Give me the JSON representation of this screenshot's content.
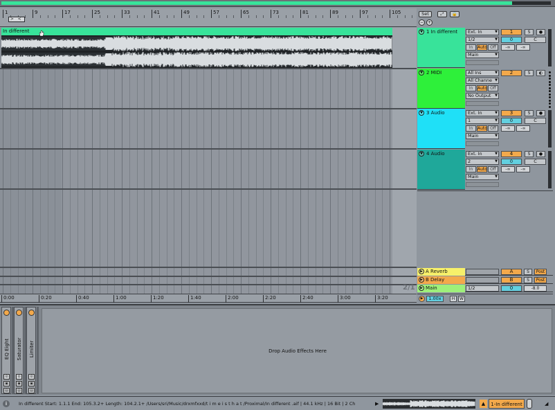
{
  "overview": {
    "fill_fraction": 0.93
  },
  "ruler": {
    "bars": [
      "1",
      "9",
      "17",
      "25",
      "33",
      "41",
      "49",
      "57",
      "65",
      "73",
      "81",
      "89",
      "97",
      "105"
    ]
  },
  "header_controls": {
    "set_label": "Set",
    "expand_glyph": "⤢",
    "lock_glyph": "🔒",
    "zoom_out_glyph": "−",
    "zoom_in_glyph": "+"
  },
  "clip": {
    "name": "In different",
    "color": "#38e39a"
  },
  "page_indicator": "2/1",
  "time_ruler": [
    "0:00",
    "0:20",
    "0:40",
    "1:00",
    "1:20",
    "1:40",
    "2:00",
    "2:20",
    "2:40",
    "3:00",
    "3:20"
  ],
  "tracks": [
    {
      "name": "1 In different",
      "color": "#38e39a",
      "input": "Ext. In",
      "channel": "1/2",
      "output": "Main",
      "mon": [
        "In",
        "Auto",
        "Off"
      ],
      "mon_on": 1,
      "num": "1",
      "solo": "S",
      "arm": "●",
      "volume": "0",
      "pan": "C",
      "peak_l": "-∞",
      "peak_r": "-∞"
    },
    {
      "name": "2 MIDI",
      "color": "#2ef03a",
      "input": "All Ins",
      "channel": "All Channe",
      "output": "No Output",
      "mon": [
        "In",
        "Auto",
        "Off"
      ],
      "mon_on": 1,
      "num": "2",
      "solo": "S",
      "arm": "◐"
    },
    {
      "name": "3 Audio",
      "color": "#1fe0f7",
      "input": "Ext. In",
      "channel": "1",
      "output": "Main",
      "mon": [
        "In",
        "Auto",
        "Off"
      ],
      "mon_on": 1,
      "num": "3",
      "solo": "S",
      "arm": "●",
      "volume": "0",
      "pan": "C",
      "peak_l": "-∞",
      "peak_r": "-∞"
    },
    {
      "name": "4 Audio",
      "color": "#1fa89a",
      "input": "Ext. In",
      "channel": "2",
      "output": "Main",
      "mon": [
        "In",
        "Auto",
        "Off"
      ],
      "mon_on": 1,
      "num": "4",
      "solo": "S",
      "arm": "●",
      "volume": "0",
      "pan": "C",
      "peak_l": "-∞",
      "peak_r": "-∞"
    }
  ],
  "returns": [
    {
      "name": "A Reverb",
      "letter": "A",
      "solo": "S",
      "post": "Post",
      "color": "#f7f06a"
    },
    {
      "name": "B Delay",
      "letter": "B",
      "solo": "S",
      "post": "Post",
      "color": "#f3a94b"
    }
  ],
  "main": {
    "name": "Main",
    "channel": "1/2",
    "volume": "0",
    "peak": "-8.0",
    "color": "#9ef07a"
  },
  "master_ctrl": {
    "tempo": "1.00x",
    "h": "H",
    "w": "W"
  },
  "devices": [
    {
      "name": "EQ Eight"
    },
    {
      "name": "Saturator"
    },
    {
      "name": "Limiter"
    }
  ],
  "drop_zone": "Drop Audio Effects Here",
  "status": {
    "text": "In different   Start: 1.1.1  End: 105.3.2+  Length: 104.2.1+  /Users/sri/Music/drxmfxxd/t i m e i s t h a t /Proximal/In different .aif | 44.1 kHz | 16 Bit | 2 Ch",
    "track_label": "1-In different"
  }
}
